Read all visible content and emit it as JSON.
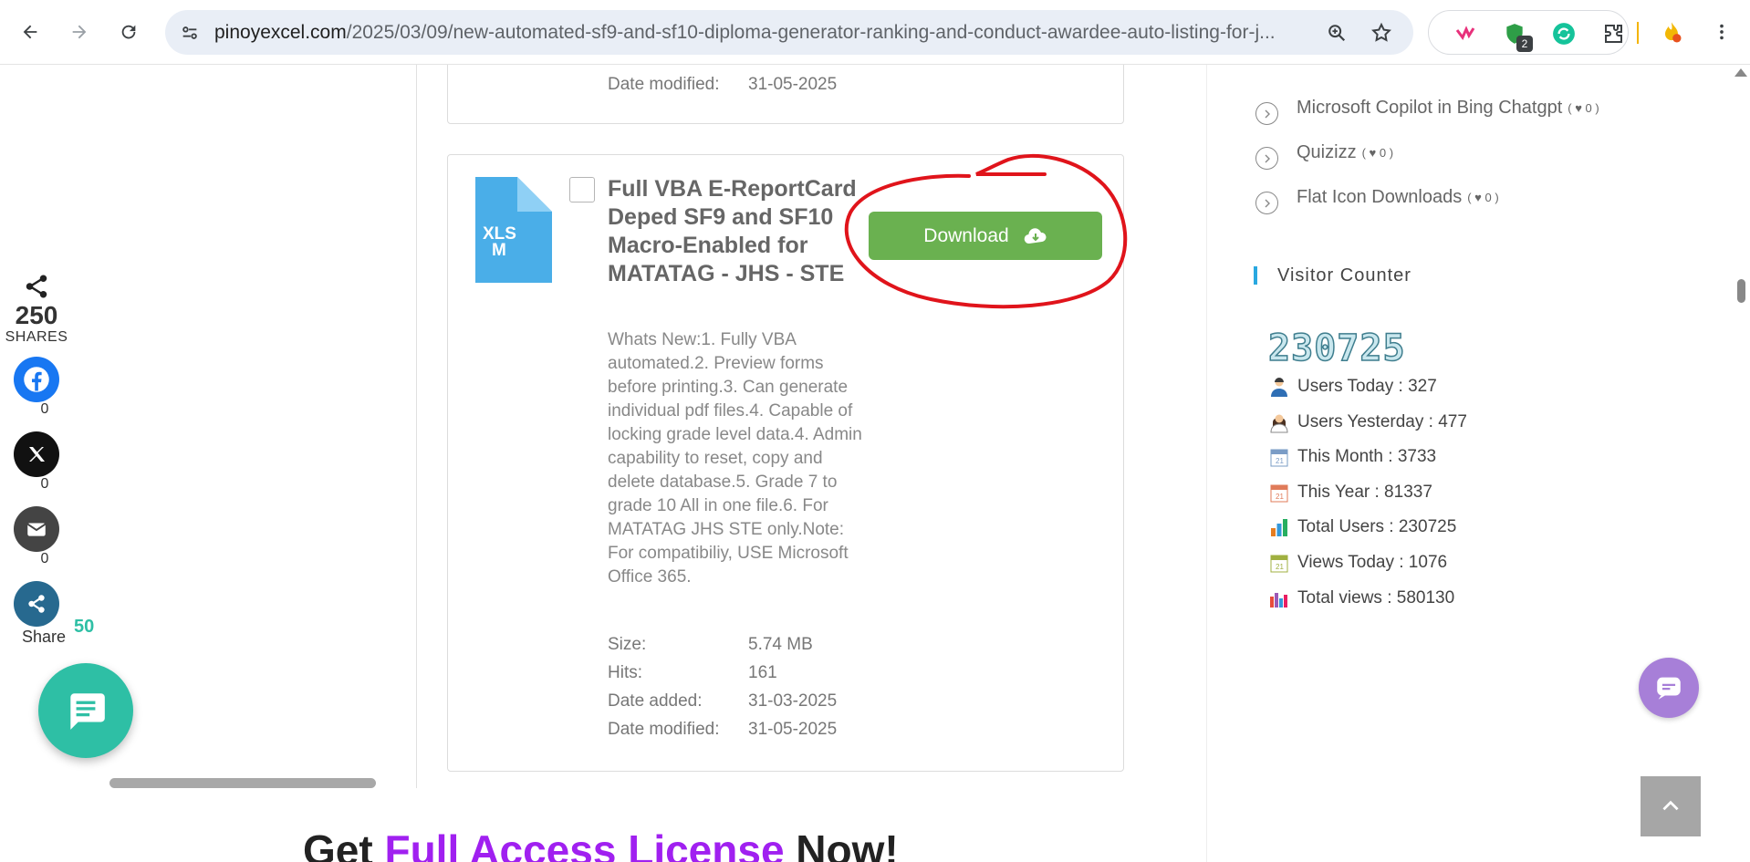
{
  "browser": {
    "url_host": "pinoyexcel.com",
    "url_path": "/2025/03/09/new-automated-sf9-and-sf10-diploma-generator-ranking-and-conduct-awardee-auto-listing-for-j...",
    "extension_badge": "2"
  },
  "share": {
    "total": "250",
    "total_label": "SHARES",
    "facebook_count": "0",
    "x_count": "0",
    "email_count": "0",
    "share_label": "Share",
    "share_count": "50"
  },
  "cards": [
    {
      "date_modified_label": "Date modified:",
      "date_modified": "31-05-2025"
    },
    {
      "file_type": "XLSM",
      "file_type_line1": "XLS",
      "file_type_line2": "M",
      "title": "Full VBA E-ReportCard Deped SF9 and SF10 Macro-Enabled for MATATAG - JHS - STE",
      "download_label": "Download",
      "description": "Whats New:1. Fully VBA automated.2. Preview forms before printing.3. Can generate individual pdf files.4. Capable of locking grade level data.4. Admin capability to reset, copy and delete database.5. Grade 7 to grade 10 All in one file.6. For MATATAG JHS STE only.Note: For compatibiliy, USE Microsoft Office 365.",
      "size_label": "Size:",
      "size": "5.74 MB",
      "hits_label": "Hits:",
      "hits": "161",
      "date_added_label": "Date added:",
      "date_added": "31-03-2025",
      "date_modified_label": "Date modified:",
      "date_modified": "31-05-2025"
    }
  ],
  "cta": {
    "prefix": "Get ",
    "highlight": "Full Access License",
    "suffix": " Now!"
  },
  "sidebar": {
    "links": [
      {
        "label": "Microsoft Copilot in Bing Chatgpt",
        "likes": "0"
      },
      {
        "label": "Quizizz",
        "likes": "0"
      },
      {
        "label": "Flat Icon Downloads",
        "likes": "0"
      }
    ],
    "visitor_counter_title": "Visitor Counter",
    "counter_digits": [
      "2",
      "3",
      "0",
      "7",
      "2",
      "5"
    ],
    "stats": [
      {
        "label": "Users Today : 327",
        "icon": "user-male-icon"
      },
      {
        "label": "Users Yesterday : 477",
        "icon": "user-female-icon"
      },
      {
        "label": "This Month : 3733",
        "icon": "calendar-icon"
      },
      {
        "label": "This Year : 81337",
        "icon": "calendar-icon"
      },
      {
        "label": "Total Users : 230725",
        "icon": "bar-chart-icon"
      },
      {
        "label": "Views Today : 1076",
        "icon": "calendar-icon"
      },
      {
        "label": "Total views : 580130",
        "icon": "bar-chart-icon"
      }
    ]
  },
  "colors": {
    "download_button": "#6ab150",
    "chat_fab": "#2ebfa5",
    "cta_highlight": "#a020f0",
    "widget_accent": "#29a8e0",
    "chat_bubble": "#a77fd8"
  }
}
